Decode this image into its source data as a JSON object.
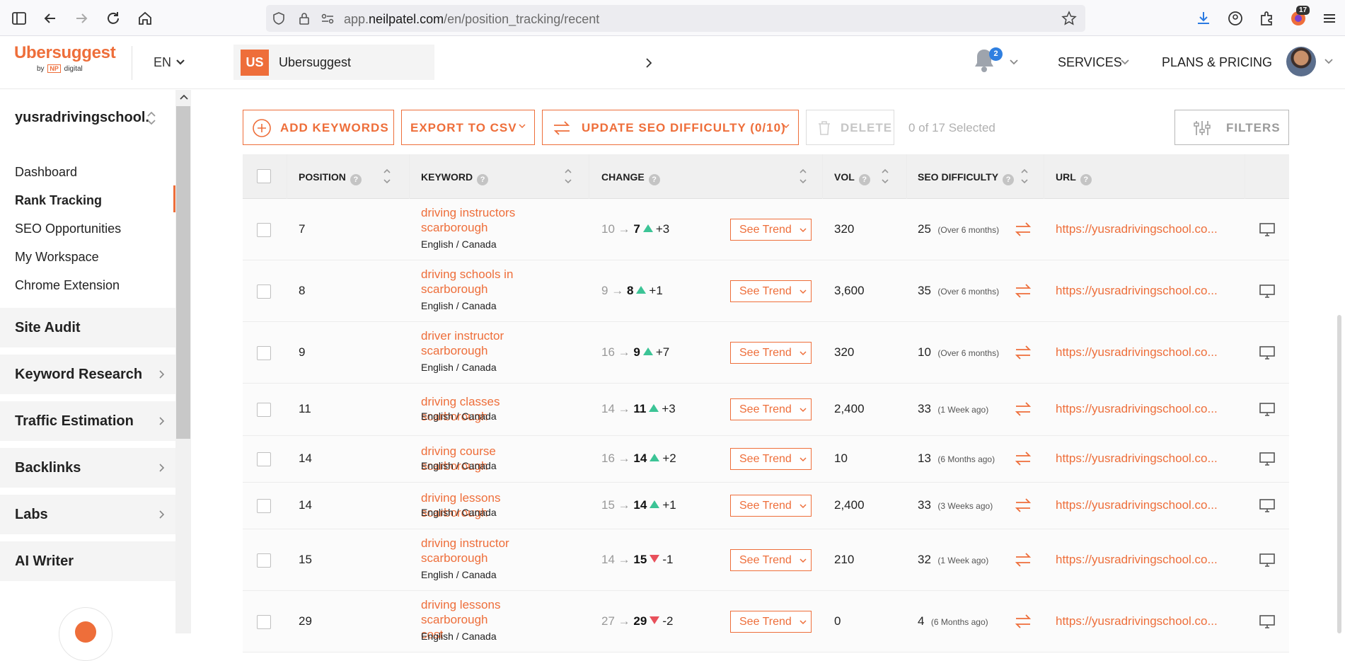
{
  "browser": {
    "url_prefix": "app.",
    "url_domain": "neilpatel.com",
    "url_path": "/en/position_tracking/recent",
    "extensions_badge": "17"
  },
  "header": {
    "logo_title": "Ubersuggest",
    "logo_by": "by",
    "logo_np": "NP",
    "logo_digital": "digital",
    "language": "EN",
    "project_badge": "US",
    "project_name": "Ubersuggest",
    "notifications_count": "2",
    "services_label": "SERVICES",
    "plans_label": "PLANS & PRICING"
  },
  "sidebar": {
    "domain": "yusradrivingschool.",
    "links": [
      {
        "label": "Dashboard"
      },
      {
        "label": "Rank Tracking"
      },
      {
        "label": "SEO Opportunities"
      },
      {
        "label": "My Workspace"
      },
      {
        "label": "Chrome Extension"
      }
    ],
    "sections": [
      {
        "label": "Site Audit"
      },
      {
        "label": "Keyword Research"
      },
      {
        "label": "Traffic Estimation"
      },
      {
        "label": "Backlinks"
      },
      {
        "label": "Labs"
      },
      {
        "label": "AI Writer"
      }
    ]
  },
  "toolbar": {
    "add_keywords": "ADD KEYWORDS",
    "export_csv": "EXPORT TO CSV",
    "update_seo": "UPDATE SEO DIFFICULTY (0/10)",
    "delete": "DELETE",
    "selected": "0 of 17 Selected",
    "filters": "FILTERS"
  },
  "table": {
    "headers": {
      "position": "POSITION",
      "keyword": "KEYWORD",
      "change": "CHANGE",
      "vol": "VOL",
      "seo_difficulty": "SEO DIFFICULTY",
      "url": "URL"
    },
    "trend_label": "See Trend",
    "arrow": "→",
    "rows": [
      {
        "position": "7",
        "kw1": "driving instructors",
        "kw2": "scarborough",
        "location": "English / Canada",
        "from": "10",
        "to": "7",
        "direction": "up",
        "delta": "+3",
        "vol": "320",
        "sd": "25",
        "sd_time": "(Over 6 months)",
        "url": "https://yusradrivingschool.co..."
      },
      {
        "position": "8",
        "kw1": "driving schools in",
        "kw2": "scarborough",
        "location": "English / Canada",
        "from": "9",
        "to": "8",
        "direction": "up",
        "delta": "+1",
        "vol": "3,600",
        "sd": "35",
        "sd_time": "(Over 6 months)",
        "url": "https://yusradrivingschool.co..."
      },
      {
        "position": "9",
        "kw1": "driver instructor",
        "kw2": "scarborough",
        "location": "English / Canada",
        "from": "16",
        "to": "9",
        "direction": "up",
        "delta": "+7",
        "vol": "320",
        "sd": "10",
        "sd_time": "(Over 6 months)",
        "url": "https://yusradrivingschool.co..."
      },
      {
        "position": "11",
        "kw1": "driving classes scarborough",
        "kw2": "",
        "location": "English / Canada",
        "from": "14",
        "to": "11",
        "direction": "up",
        "delta": "+3",
        "vol": "2,400",
        "sd": "33",
        "sd_time": "(1 Week ago)",
        "url": "https://yusradrivingschool.co..."
      },
      {
        "position": "14",
        "kw1": "driving course scarborough",
        "kw2": "",
        "location": "English / Canada",
        "from": "16",
        "to": "14",
        "direction": "up",
        "delta": "+2",
        "vol": "10",
        "sd": "13",
        "sd_time": "(6 Months ago)",
        "url": "https://yusradrivingschool.co..."
      },
      {
        "position": "14",
        "kw1": "driving lessons scarborough",
        "kw2": "",
        "location": "English / Canada",
        "from": "15",
        "to": "14",
        "direction": "up",
        "delta": "+1",
        "vol": "2,400",
        "sd": "33",
        "sd_time": "(3 Weeks ago)",
        "url": "https://yusradrivingschool.co..."
      },
      {
        "position": "15",
        "kw1": "driving instructor",
        "kw2": "scarborough",
        "location": "English / Canada",
        "from": "14",
        "to": "15",
        "direction": "down",
        "delta": "-1",
        "vol": "210",
        "sd": "32",
        "sd_time": "(1 Week ago)",
        "url": "https://yusradrivingschool.co..."
      },
      {
        "position": "29",
        "kw1": "driving lessons scarborough",
        "kw2": "cost",
        "location": "English / Canada",
        "from": "27",
        "to": "29",
        "direction": "down",
        "delta": "-2",
        "vol": "0",
        "sd": "4",
        "sd_time": "(6 Months ago)",
        "url": "https://yusradrivingschool.co..."
      }
    ]
  },
  "colors": {
    "accent": "#ee6e3a",
    "up": "#3cc496",
    "down": "#e8505b",
    "badge_blue": "#2f7fe0"
  }
}
